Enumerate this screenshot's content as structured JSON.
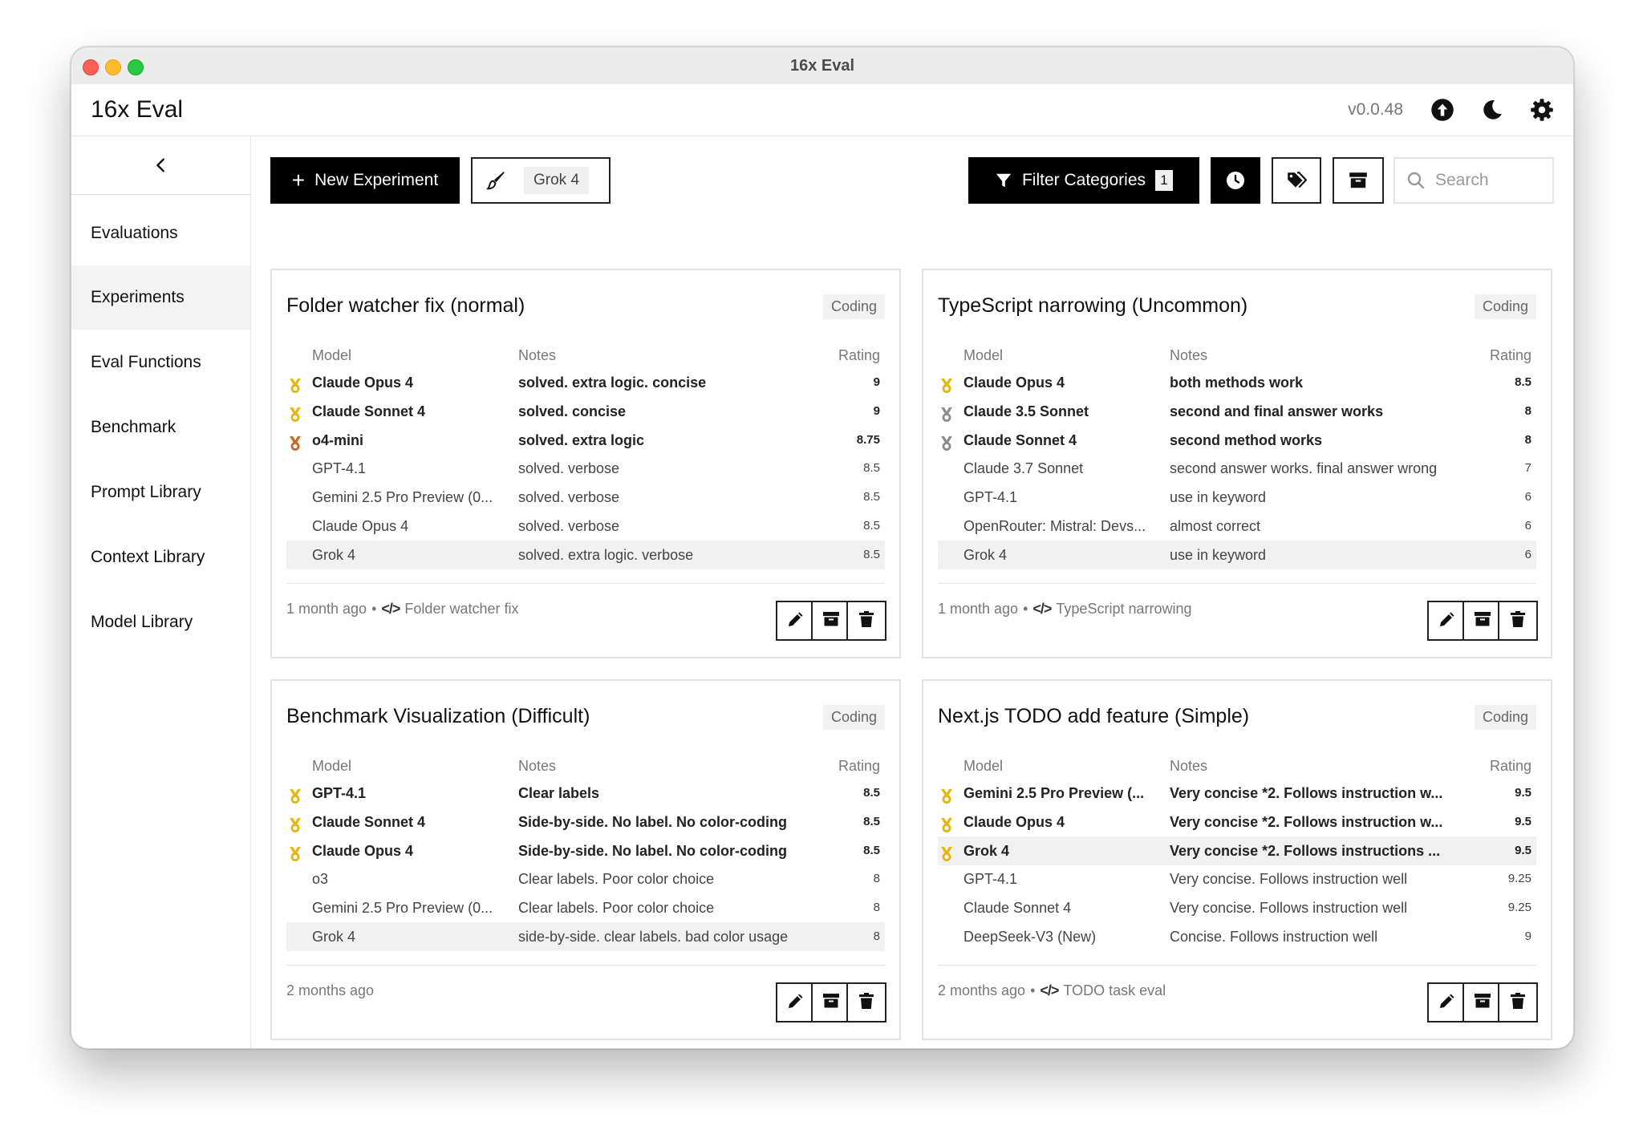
{
  "window": {
    "title": "16x Eval"
  },
  "header": {
    "app_name": "16x Eval",
    "version": "v0.0.48",
    "icons": [
      "upload-icon",
      "moon-icon",
      "gear-icon"
    ]
  },
  "sidebar": {
    "collapse_icon": "chevron-left-icon",
    "items": [
      {
        "label": "Evaluations"
      },
      {
        "label": "Experiments",
        "active": true
      },
      {
        "label": "Eval Functions"
      },
      {
        "label": "Benchmark"
      },
      {
        "label": "Prompt Library"
      },
      {
        "label": "Context Library"
      },
      {
        "label": "Model Library"
      }
    ]
  },
  "toolbar": {
    "new_experiment_label": "New Experiment",
    "model_chip": "Grok 4",
    "filter_label": "Filter Categories",
    "filter_count": "1",
    "search_placeholder": "Search"
  },
  "colors": {
    "gold": "#e7b416",
    "silver": "#8e8e8e",
    "bronze": "#c26b2c",
    "primary": "#000000"
  },
  "cards": [
    {
      "title": "Folder watcher fix (normal)",
      "category": "Coding",
      "headers": {
        "model": "Model",
        "notes": "Notes",
        "rating": "Rating"
      },
      "rows": [
        {
          "medal": "gold",
          "model": "Claude Opus 4",
          "notes": "solved. extra logic. concise",
          "rating": "9"
        },
        {
          "medal": "gold",
          "model": "Claude Sonnet 4",
          "notes": "solved. concise",
          "rating": "9"
        },
        {
          "medal": "bronze",
          "model": "o4-mini",
          "notes": "solved. extra logic",
          "rating": "8.75"
        },
        {
          "medal": "",
          "model": "GPT-4.1",
          "notes": "solved. verbose",
          "rating": "8.5"
        },
        {
          "medal": "",
          "model": "Gemini 2.5 Pro Preview (0...",
          "notes": "solved. verbose",
          "rating": "8.5"
        },
        {
          "medal": "",
          "model": "Claude Opus 4",
          "notes": "solved. verbose",
          "rating": "8.5"
        },
        {
          "medal": "",
          "model": "Grok 4",
          "notes": "solved. extra logic. verbose",
          "rating": "8.5",
          "selected": true
        }
      ],
      "meta_time": "1 month ago",
      "meta_prompt": "Folder watcher fix"
    },
    {
      "title": "TypeScript narrowing (Uncommon)",
      "category": "Coding",
      "headers": {
        "model": "Model",
        "notes": "Notes",
        "rating": "Rating"
      },
      "rows": [
        {
          "medal": "gold",
          "model": "Claude Opus 4",
          "notes": "both methods work",
          "rating": "8.5"
        },
        {
          "medal": "silver",
          "model": "Claude 3.5 Sonnet",
          "notes": "second and final answer works",
          "rating": "8"
        },
        {
          "medal": "silver",
          "model": "Claude Sonnet 4",
          "notes": "second method works",
          "rating": "8"
        },
        {
          "medal": "",
          "model": "Claude 3.7 Sonnet",
          "notes": "second answer works. final answer wrong",
          "rating": "7"
        },
        {
          "medal": "",
          "model": "GPT-4.1",
          "notes": "use in keyword",
          "rating": "6"
        },
        {
          "medal": "",
          "model": "OpenRouter: Mistral: Devs...",
          "notes": "almost correct",
          "rating": "6"
        },
        {
          "medal": "",
          "model": "Grok 4",
          "notes": "use in keyword",
          "rating": "6",
          "selected": true
        }
      ],
      "meta_time": "1 month ago",
      "meta_prompt": "TypeScript narrowing"
    },
    {
      "title": "Benchmark Visualization (Difficult)",
      "category": "Coding",
      "headers": {
        "model": "Model",
        "notes": "Notes",
        "rating": "Rating"
      },
      "rows": [
        {
          "medal": "gold",
          "model": "GPT-4.1",
          "notes": "Clear labels",
          "rating": "8.5"
        },
        {
          "medal": "gold",
          "model": "Claude Sonnet 4",
          "notes": "Side-by-side. No label. No color-coding",
          "rating": "8.5"
        },
        {
          "medal": "gold",
          "model": "Claude Opus 4",
          "notes": "Side-by-side. No label. No color-coding",
          "rating": "8.5"
        },
        {
          "medal": "",
          "model": "o3",
          "notes": "Clear labels. Poor color choice",
          "rating": "8"
        },
        {
          "medal": "",
          "model": "Gemini 2.5 Pro Preview (0...",
          "notes": "Clear labels. Poor color choice",
          "rating": "8"
        },
        {
          "medal": "",
          "model": "Grok 4",
          "notes": "side-by-side. clear labels. bad color usage",
          "rating": "8",
          "selected": true
        }
      ],
      "meta_time": "2 months ago",
      "meta_prompt": ""
    },
    {
      "title": "Next.js TODO add feature (Simple)",
      "category": "Coding",
      "headers": {
        "model": "Model",
        "notes": "Notes",
        "rating": "Rating"
      },
      "rows": [
        {
          "medal": "gold",
          "model": "Gemini 2.5 Pro Preview (...",
          "notes": "Very concise *2. Follows instruction w...",
          "rating": "9.5"
        },
        {
          "medal": "gold",
          "model": "Claude Opus 4",
          "notes": "Very concise *2. Follows instruction w...",
          "rating": "9.5"
        },
        {
          "medal": "gold",
          "model": "Grok 4",
          "notes": "Very concise *2. Follows instructions ...",
          "rating": "9.5",
          "selected": true
        },
        {
          "medal": "",
          "model": "GPT-4.1",
          "notes": "Very concise. Follows instruction well",
          "rating": "9.25"
        },
        {
          "medal": "",
          "model": "Claude Sonnet 4",
          "notes": "Very concise. Follows instruction well",
          "rating": "9.25"
        },
        {
          "medal": "",
          "model": "DeepSeek-V3 (New)",
          "notes": "Concise. Follows instruction well",
          "rating": "9"
        }
      ],
      "meta_time": "2 months ago",
      "meta_prompt": "TODO task eval"
    }
  ]
}
